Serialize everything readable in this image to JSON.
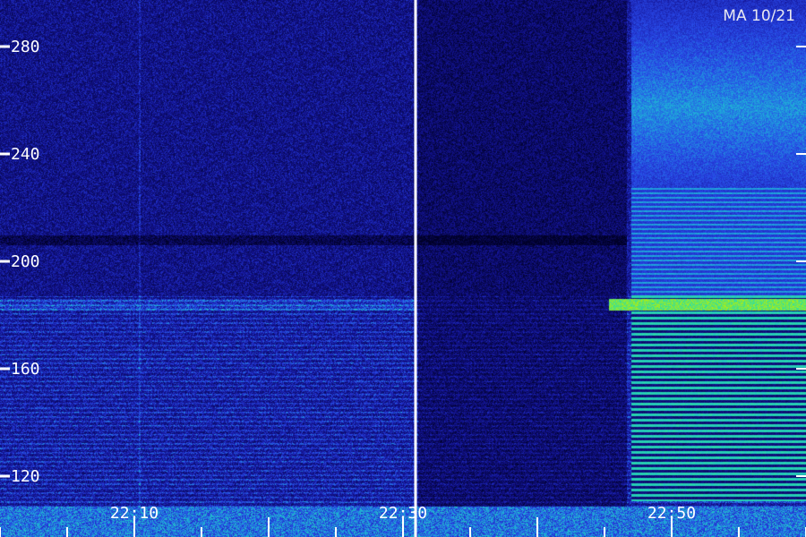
{
  "chart_data": {
    "type": "heatmap",
    "title": "",
    "stamp": "MA 10/21",
    "xlabel": "",
    "ylabel": "",
    "x_ticks": [
      "22:10",
      "22:30",
      "22:50"
    ],
    "y_ticks": [
      280,
      240,
      200,
      160,
      120
    ],
    "y_range": [
      110,
      290
    ],
    "bright_band_level": 184,
    "dark_band_level": 208,
    "colors": {
      "background": "#00003c",
      "noise": "#2028c0",
      "band": "#30d0c0",
      "hot": "#b8f000",
      "divider": "#ffffff"
    }
  }
}
